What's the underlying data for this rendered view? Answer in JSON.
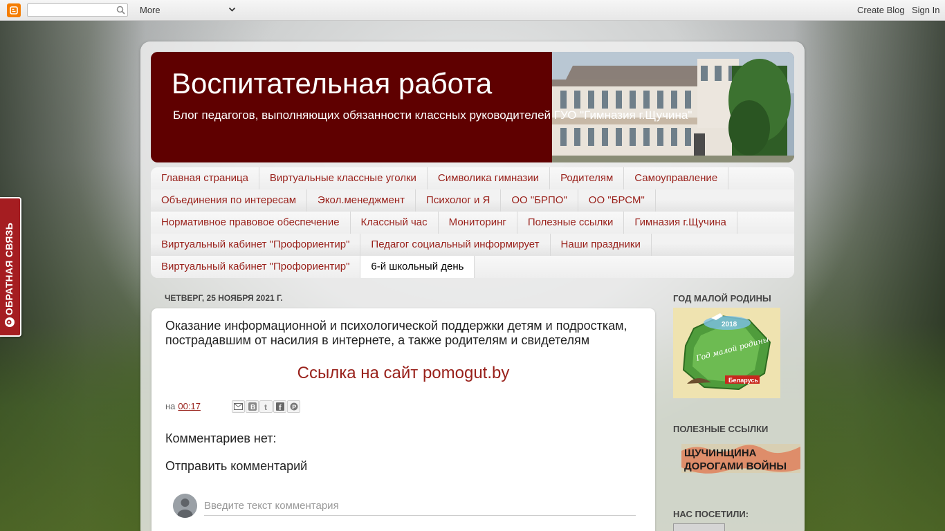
{
  "navbar": {
    "search_placeholder": "",
    "more_label": "More",
    "create_blog_label": "Create Blog",
    "sign_in_label": "Sign In"
  },
  "feedback": {
    "label": "ОБРАТНАЯ СВЯЗЬ"
  },
  "header": {
    "title": "Воспитательная работа",
    "description": "Блог педагогов, выполняющих обязанности классных руководителей ГУО \"Гимназия г.Щучина\""
  },
  "tabs": {
    "rows": [
      [
        "Главная страница",
        "Виртуальные классные уголки",
        "Символика гимназии",
        "Родителям",
        "Самоуправление"
      ],
      [
        "Объединения по интересам",
        "Экол.менеджмент",
        "Психолог и Я",
        "ОО \"БРПО\"",
        "ОО \"БРСМ\""
      ],
      [
        "Нормативное правовое обеспечение",
        "Классный час",
        "Мониторинг",
        "Полезные ссылки",
        "Гимназия г.Щучина"
      ],
      [
        "Виртуальный кабинет \"Профориентир\"",
        "Педагог социальный информирует",
        "Наши праздники"
      ],
      [
        "Виртуальный кабинет \"Профориентир\"",
        "6-й школьный день"
      ]
    ],
    "selected": "6-й школьный день"
  },
  "post": {
    "date": "ЧЕТВЕРГ, 25 НОЯБРЯ 2021 Г.",
    "title": "Оказание информационной и психологической поддержки детям и подросткам, пострадавшим от насилия в интернете, а также родителям и свидетелям",
    "link_text": "Ссылка на сайт pomogut.by",
    "posted_prefix": "на",
    "time": "00:17",
    "share_icons": [
      "email-icon",
      "blog-this-icon",
      "twitter-icon",
      "facebook-icon",
      "pinterest-icon"
    ],
    "no_comments": "Комментариев нет:",
    "post_comment": "Отправить комментарий",
    "comment_placeholder": "Введите текст комментария"
  },
  "sidebar": {
    "gadget1_title": "ГОД МАЛОЙ РОДИНЫ",
    "gadget1_image_text": [
      "2018",
      "Год малой родины",
      "Беларусь"
    ],
    "gadget2_title": "ПОЛЕЗНЫЕ ССЫЛКИ",
    "gadget2_image_text": [
      "ЩУЧИНЩИНА",
      "ДОРОГАМИ ВОЙНЫ"
    ],
    "gadget3_title": "НАС ПОСЕТИЛИ:"
  },
  "colors": {
    "header_bg": "#5f0000",
    "link": "#99211b",
    "feedback_bg": "#a51d21",
    "blogger_orange": "#f57d00"
  }
}
